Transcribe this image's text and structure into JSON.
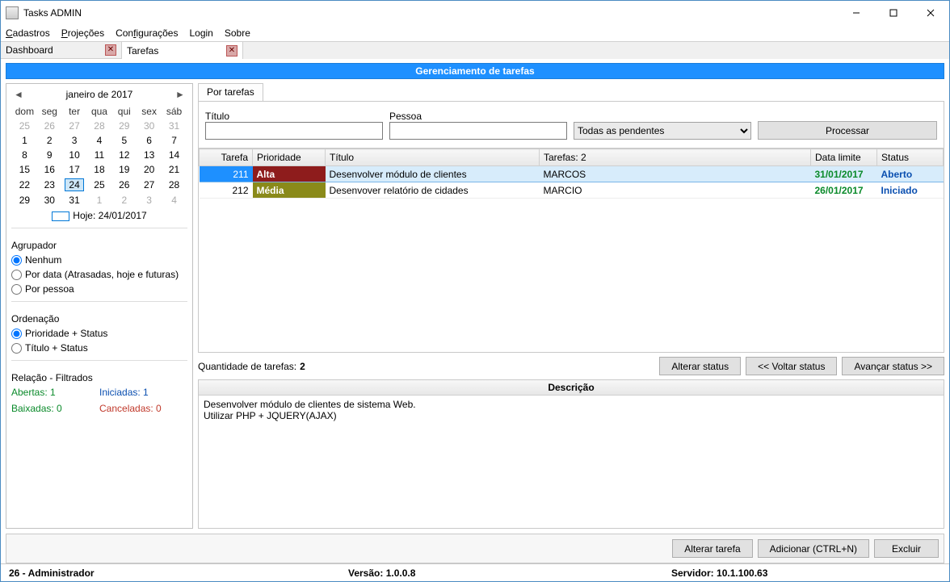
{
  "window": {
    "title": "Tasks ADMIN"
  },
  "menu": {
    "cadastros": "Cadastros",
    "projecoes": "Projeções",
    "configuracoes": "Configurações",
    "login": "Login",
    "sobre": "Sobre"
  },
  "tabs": {
    "dashboard": "Dashboard",
    "tarefas": "Tarefas"
  },
  "banner": "Gerenciamento de tarefas",
  "calendar": {
    "title": "janeiro de 2017",
    "dow": [
      "dom",
      "seg",
      "ter",
      "qua",
      "qui",
      "sex",
      "sáb"
    ],
    "rows": [
      [
        {
          "d": "25",
          "dim": true
        },
        {
          "d": "26",
          "dim": true
        },
        {
          "d": "27",
          "dim": true
        },
        {
          "d": "28",
          "dim": true
        },
        {
          "d": "29",
          "dim": true
        },
        {
          "d": "30",
          "dim": true
        },
        {
          "d": "31",
          "dim": true
        }
      ],
      [
        {
          "d": "1"
        },
        {
          "d": "2"
        },
        {
          "d": "3"
        },
        {
          "d": "4"
        },
        {
          "d": "5"
        },
        {
          "d": "6"
        },
        {
          "d": "7"
        }
      ],
      [
        {
          "d": "8"
        },
        {
          "d": "9"
        },
        {
          "d": "10"
        },
        {
          "d": "11"
        },
        {
          "d": "12"
        },
        {
          "d": "13"
        },
        {
          "d": "14"
        }
      ],
      [
        {
          "d": "15"
        },
        {
          "d": "16"
        },
        {
          "d": "17"
        },
        {
          "d": "18"
        },
        {
          "d": "19"
        },
        {
          "d": "20"
        },
        {
          "d": "21"
        }
      ],
      [
        {
          "d": "22"
        },
        {
          "d": "23"
        },
        {
          "d": "24",
          "today": true
        },
        {
          "d": "25"
        },
        {
          "d": "26"
        },
        {
          "d": "27"
        },
        {
          "d": "28"
        }
      ],
      [
        {
          "d": "29"
        },
        {
          "d": "30"
        },
        {
          "d": "31"
        },
        {
          "d": "1",
          "dim": true
        },
        {
          "d": "2",
          "dim": true
        },
        {
          "d": "3",
          "dim": true
        },
        {
          "d": "4",
          "dim": true
        }
      ]
    ],
    "today_label": "Hoje: 24/01/2017"
  },
  "agrupador": {
    "label": "Agrupador",
    "nenhum": "Nenhum",
    "pordata": "Por data (Atrasadas, hoje e futuras)",
    "porpessoa": "Por pessoa"
  },
  "ordenacao": {
    "label": "Ordenação",
    "prio": "Prioridade + Status",
    "titulo": "Título + Status"
  },
  "relacao": {
    "label": "Relação - Filtrados",
    "abertas": "Abertas: 1",
    "iniciadas": "Iniciadas: 1",
    "baixadas": "Baixadas: 0",
    "canceladas": "Canceladas: 0"
  },
  "subtab": "Por tarefas",
  "filters": {
    "titulo_label": "Título",
    "pessoa_label": "Pessoa",
    "titulo_value": "",
    "pessoa_value": "",
    "select_value": "Todas as pendentes",
    "processar": "Processar"
  },
  "grid": {
    "headers": {
      "tarefa": "Tarefa",
      "prioridade": "Prioridade",
      "titulo": "Título",
      "tarefas": "Tarefas: 2",
      "datalimite": "Data limite",
      "status": "Status"
    },
    "rows": [
      {
        "id": "211",
        "prio": "Alta",
        "prio_class": "prio-alta",
        "titulo": "Desenvolver módulo de clientes",
        "pessoa": "MARCOS",
        "data": "31/01/2017",
        "status": "Aberto",
        "selected": true
      },
      {
        "id": "212",
        "prio": "Média",
        "prio_class": "prio-media",
        "titulo": "Desenvover relatório de cidades",
        "pessoa": "MARCIO",
        "data": "26/01/2017",
        "status": "Iniciado",
        "selected": false
      }
    ]
  },
  "midbar": {
    "qty_label": "Quantidade de tarefas: ",
    "qty_value": "2",
    "alterar_status": "Alterar status",
    "voltar_status": "<< Voltar status",
    "avancar_status": "Avançar status >>"
  },
  "descricao": {
    "header": "Descrição",
    "body": "Desenvolver módulo de clientes de sistema Web.\nUtilizar PHP + JQUERY(AJAX)"
  },
  "footerbtns": {
    "alterar_tarefa": "Alterar tarefa",
    "adicionar": "Adicionar (CTRL+N)",
    "excluir": "Excluir"
  },
  "statusbar": {
    "user": "26 - Administrador",
    "versao": "Versão: 1.0.0.8",
    "servidor": "Servidor: 10.1.100.63"
  }
}
